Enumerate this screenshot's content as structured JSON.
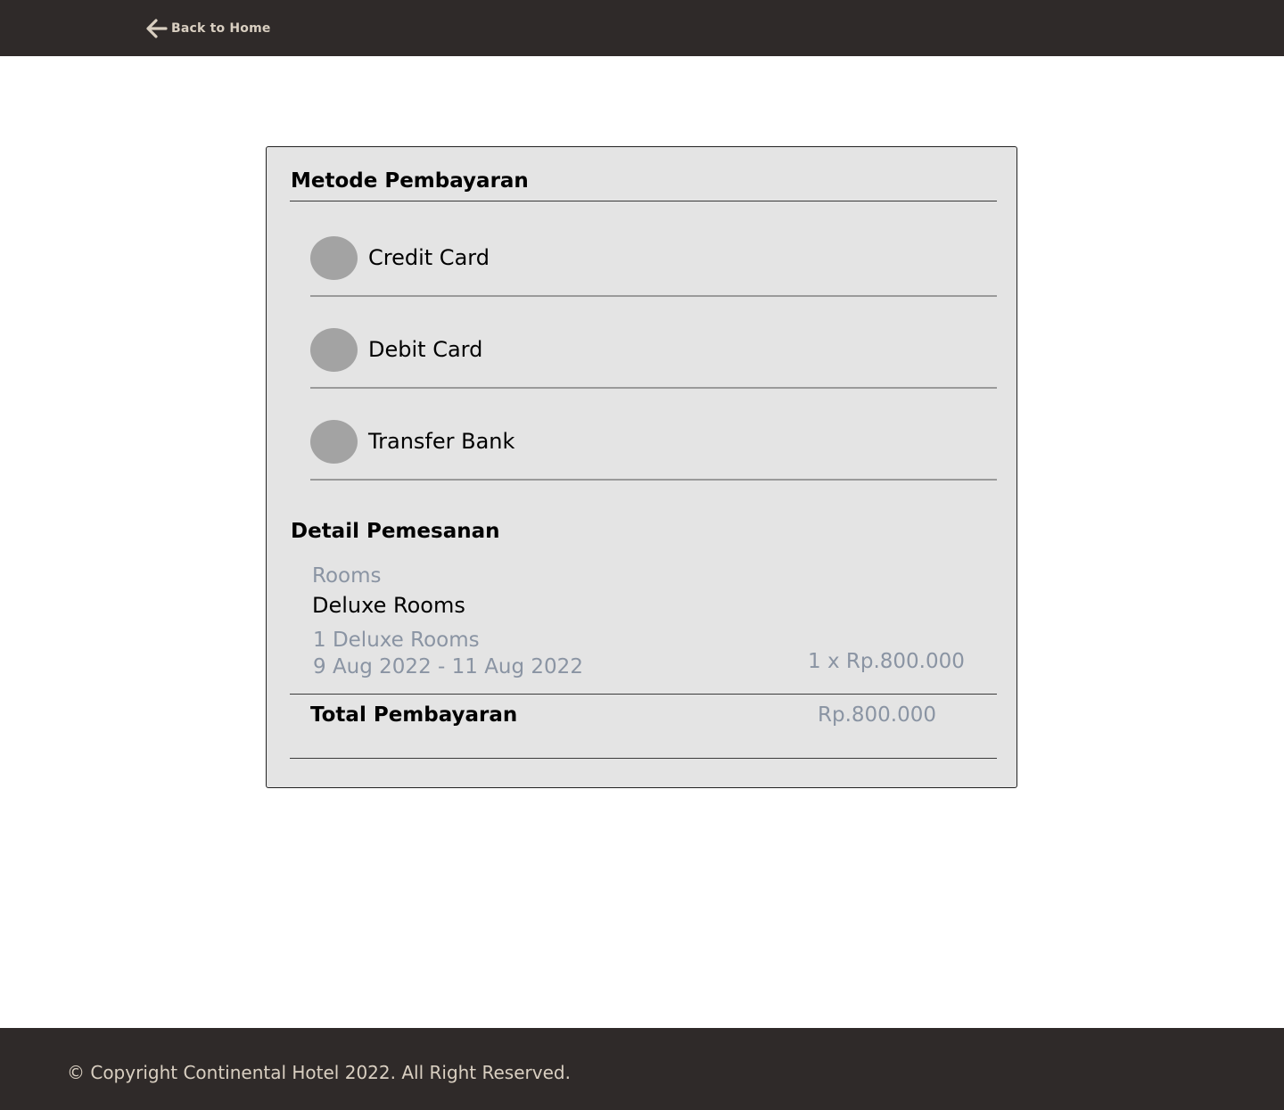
{
  "header": {
    "back_label": "Back to Home",
    "icon": "arrow-left-icon"
  },
  "payment": {
    "title": "Metode Pembayaran",
    "methods": [
      {
        "label": "Credit Card"
      },
      {
        "label": "Debit Card"
      },
      {
        "label": "Transfer Bank"
      }
    ]
  },
  "order": {
    "title": "Detail Pemesanan",
    "rooms_label": "Rooms",
    "room_name": "Deluxe Rooms",
    "quantity": "1 Deluxe Rooms",
    "dates": "9 Aug 2022 - 11 Aug 2022",
    "unit_price": "1 x Rp.800.000",
    "total_label": "Total Pembayaran",
    "total_value": "Rp.800.000"
  },
  "footer": {
    "copyright": "© Copyright Continental Hotel 2022. All Right Reserved."
  },
  "colors": {
    "bar": "#2f2a29",
    "bar_text": "#d9cfc1",
    "card_bg": "#e4e4e4",
    "radio": "#a3a3a3",
    "muted_text": "#8a94a3"
  }
}
